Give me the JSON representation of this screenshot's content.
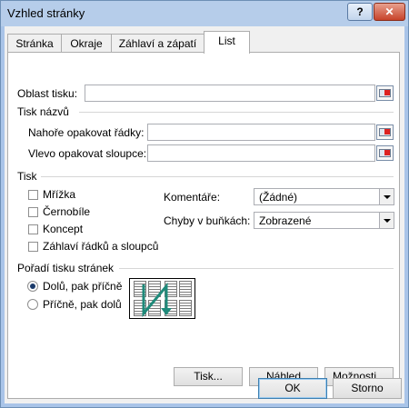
{
  "window": {
    "title": "Vzhled stránky",
    "help_label": "?",
    "close_label": "✕"
  },
  "tabs": [
    {
      "label": "Stránka",
      "active": false
    },
    {
      "label": "Okraje",
      "active": false
    },
    {
      "label": "Záhlaví a zápatí",
      "active": false
    },
    {
      "label": "List",
      "active": true
    }
  ],
  "print_area": {
    "label": "Oblast tisku:",
    "value": ""
  },
  "print_titles": {
    "section": "Tisk názvů",
    "rows_label": "Nahoře opakovat řádky:",
    "rows_value": "",
    "cols_label": "Vlevo opakovat sloupce:",
    "cols_value": ""
  },
  "print": {
    "section": "Tisk",
    "checkboxes": [
      {
        "label": "Mřížka",
        "checked": false
      },
      {
        "label": "Černobíle",
        "checked": false
      },
      {
        "label": "Koncept",
        "checked": false
      },
      {
        "label": "Záhlaví řádků a sloupců",
        "checked": false
      }
    ],
    "comments_label": "Komentáře:",
    "comments_value": "(Žádné)",
    "errors_label": "Chyby v buňkách:",
    "errors_value": "Zobrazené"
  },
  "page_order": {
    "section": "Pořadí tisku stránek",
    "options": [
      {
        "label": "Dolů, pak příčně",
        "selected": true
      },
      {
        "label": "Příčně, pak dolů",
        "selected": false
      }
    ],
    "arrow_color": "#1f8a7a"
  },
  "buttons": {
    "print": "Tisk...",
    "preview": "Náhled",
    "options": "Možnosti...",
    "ok": "OK",
    "cancel": "Storno"
  },
  "icons": {
    "range_picker": "range-picker-icon"
  }
}
